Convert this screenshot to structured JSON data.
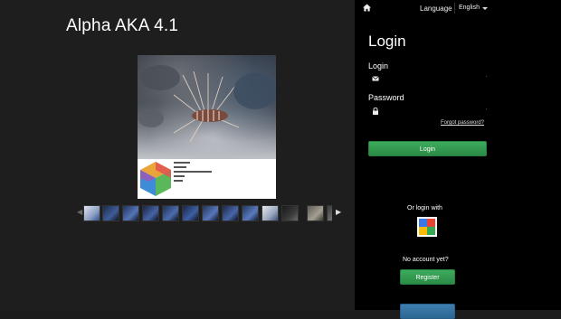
{
  "app": {
    "title": "Alpha AKA 4.1"
  },
  "topbar": {
    "home_icon": "home-icon",
    "language_label": "Language",
    "language_value": "English",
    "caret_icon": "caret-down-icon"
  },
  "login": {
    "heading": "Login",
    "login_label": "Login",
    "login_icon": "envelope-icon",
    "login_value": "",
    "password_label": "Password",
    "password_icon": "lock-icon",
    "password_value": "",
    "forgot_label": "Forgot password?",
    "submit_label": "Login",
    "or_login_with": "Or login with",
    "social_icon": "google-icon",
    "no_account": "No account yet?",
    "register_label": "Register"
  },
  "gallery": {
    "prev_icon": "chevron-left-icon",
    "next_icon": "chevron-right-icon",
    "thumbnail_count": 13
  },
  "colors": {
    "accent_green": "#2f9a4f",
    "accent_blue": "#3579ac",
    "background": "#1e1e1e",
    "panel": "#000000"
  }
}
